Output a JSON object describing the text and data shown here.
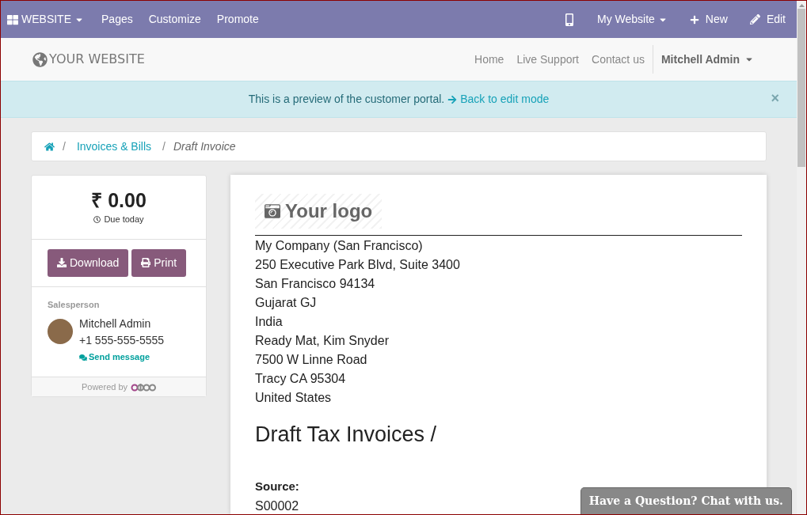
{
  "editor_bar": {
    "app_menu": "WEBSITE",
    "items": [
      "Pages",
      "Customize",
      "Promote"
    ],
    "website": "My Website",
    "new": "New",
    "edit": "Edit"
  },
  "header": {
    "brand": "YOUR WEBSITE",
    "nav": [
      {
        "label": "Home"
      },
      {
        "label": "Live Support"
      },
      {
        "label": "Contact us"
      }
    ],
    "user": "Mitchell Admin"
  },
  "alert": {
    "text": "This is a preview of the customer portal.",
    "link": "Back to edit mode",
    "close": "×"
  },
  "breadcrumb": {
    "items": [
      "Invoices & Bills"
    ],
    "separator": "/",
    "current": "Draft Invoice"
  },
  "summary": {
    "amount": "₹ 0.00",
    "due": "Due today",
    "buttons": [
      {
        "label": "Download",
        "kind": "download"
      },
      {
        "label": "Print",
        "kind": "print"
      }
    ],
    "salesperson_label": "Salesperson",
    "name": "Mitchell Admin",
    "phone": "+1 555-555-5555",
    "send": "Send message",
    "powered": "Powered by"
  },
  "document": {
    "logo": "Your logo",
    "address": [
      "My Company (San Francisco)",
      "250 Executive Park Blvd, Suite 3400",
      "San Francisco 94134",
      "Gujarat GJ",
      "India",
      "Ready Mat, Kim Snyder",
      "7500 W Linne Road",
      "Tracy CA 95304",
      "United States"
    ],
    "title": "Draft Tax Invoices /",
    "source_label": "Source:",
    "source": "S00002"
  },
  "chat": "Have a Question? Chat with us."
}
